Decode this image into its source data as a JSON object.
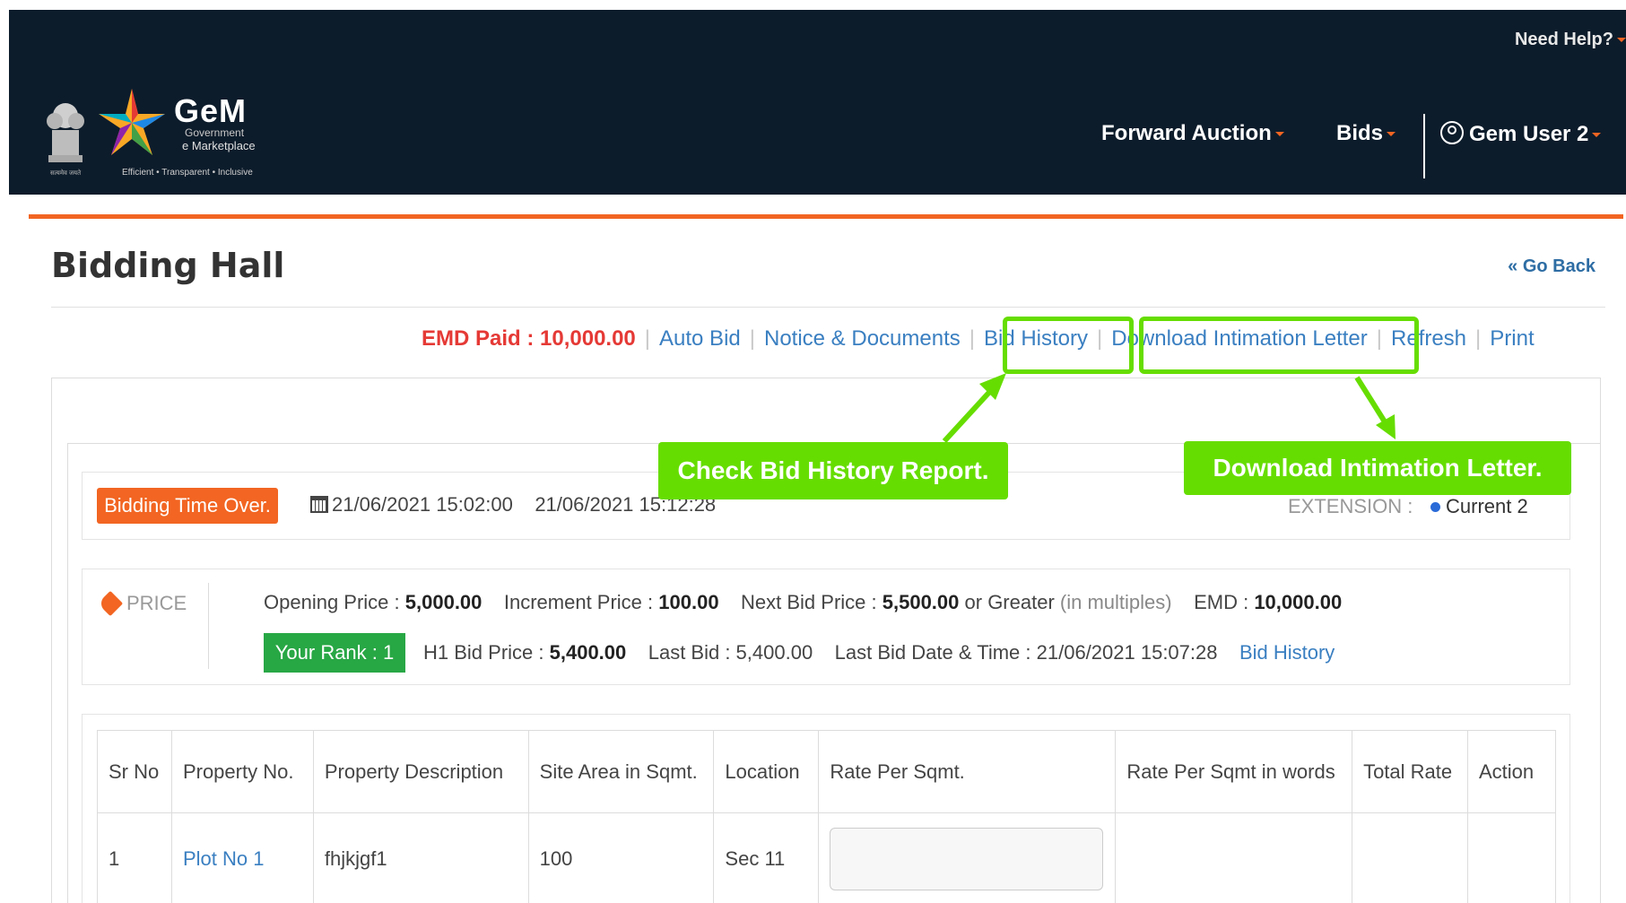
{
  "header": {
    "help_label": "Need Help?",
    "logo": {
      "name": "GeM",
      "line1": "Government",
      "line2": "e Marketplace",
      "tagline": "Efficient • Transparent • Inclusive",
      "emblem_caption": "सत्यमेव जयते"
    },
    "nav": [
      {
        "label": "Forward Auction"
      },
      {
        "label": "Bids"
      },
      {
        "label": "Gem User 2"
      }
    ]
  },
  "page": {
    "title": "Bidding Hall",
    "go_back": "« Go Back"
  },
  "actions": {
    "emd_paid": "EMD Paid : 10,000.00",
    "links": [
      "Auto Bid",
      "Notice & Documents",
      "Bid History",
      "Download Intimation Letter",
      "Refresh",
      "Print"
    ]
  },
  "timing": {
    "status": "Bidding Time Over.",
    "start": "21/06/2021 15:02:00",
    "end": "21/06/2021 15:12:28",
    "extension_label": "EXTENSION :",
    "current": "Current 2"
  },
  "price": {
    "label": "PRICE",
    "opening_label": "Opening Price :",
    "opening_value": "5,000.00",
    "increment_label": "Increment Price :",
    "increment_value": "100.00",
    "next_bid_label": "Next Bid Price :",
    "next_bid_value": "5,500.00",
    "next_bid_suffix": "or Greater",
    "next_bid_note": "(in multiples)",
    "emd_label": "EMD :",
    "emd_value": "10,000.00",
    "rank": "Your Rank : 1",
    "h1_label": "H1 Bid Price :",
    "h1_value": "5,400.00",
    "last_bid": "Last Bid : 5,400.00",
    "last_bid_time": "Last Bid Date & Time : 21/06/2021 15:07:28",
    "history_link": "Bid History"
  },
  "table": {
    "headers": [
      "Sr No",
      "Property No.",
      "Property Description",
      "Site Area in Sqmt.",
      "Location",
      "Rate Per Sqmt.",
      "Rate Per Sqmt in words",
      "Total Rate",
      "Action"
    ],
    "rows": [
      [
        "1",
        "Plot No 1",
        "fhjkjgf1",
        "100",
        "Sec 11",
        "",
        "",
        "",
        ""
      ]
    ]
  },
  "annotations": {
    "bid_history_callout": "Check Bid History Report.",
    "download_callout": "Download Intimation Letter."
  },
  "colors": {
    "header_bg": "#0d1c2b",
    "accent_orange": "#f26522",
    "link_blue": "#3a7fc1",
    "emd_red": "#e53935",
    "rank_green": "#28a745",
    "callout_green": "#66dd00"
  }
}
